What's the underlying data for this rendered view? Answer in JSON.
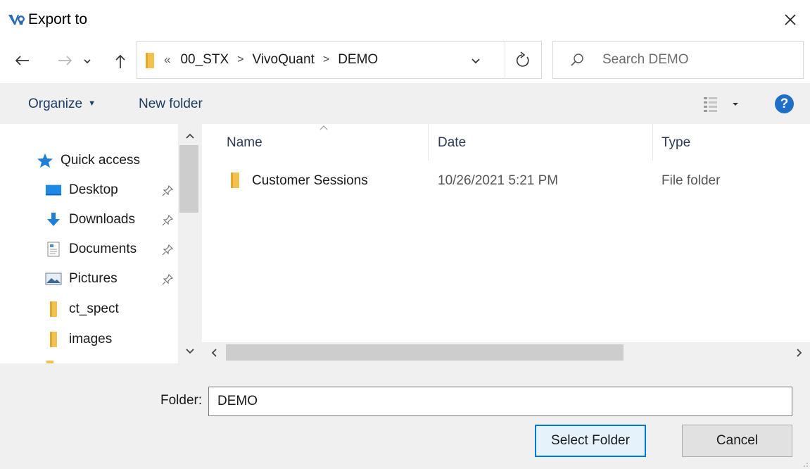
{
  "window": {
    "title": "Export to"
  },
  "nav": {
    "back_icon": "back-arrow-icon",
    "forward_icon": "forward-arrow-icon",
    "recent_icon": "chevron-down-icon",
    "up_icon": "up-arrow-icon",
    "breadcrumb": {
      "overflow": "«",
      "items": [
        "00_STX",
        "VivoQuant",
        "DEMO"
      ],
      "separator": ">"
    },
    "refresh_icon": "refresh-icon",
    "search_placeholder": "Search DEMO"
  },
  "toolbar": {
    "organize_label": "Organize",
    "new_folder_label": "New folder",
    "help_label": "?"
  },
  "sidebar": {
    "items": [
      {
        "label": "Quick access",
        "icon": "star-icon",
        "pinned": false
      },
      {
        "label": "Desktop",
        "icon": "desktop-icon",
        "pinned": true
      },
      {
        "label": "Downloads",
        "icon": "download-icon",
        "pinned": true
      },
      {
        "label": "Documents",
        "icon": "documents-icon",
        "pinned": true
      },
      {
        "label": "Pictures",
        "icon": "pictures-icon",
        "pinned": true
      },
      {
        "label": "ct_spect",
        "icon": "folder-icon",
        "pinned": false
      },
      {
        "label": "images",
        "icon": "folder-icon",
        "pinned": false
      }
    ]
  },
  "files": {
    "columns": [
      "Name",
      "Date",
      "Type"
    ],
    "rows": [
      {
        "name": "Customer Sessions",
        "date": "10/26/2021 5:21 PM",
        "type": "File folder"
      }
    ]
  },
  "footer": {
    "folder_label": "Folder:",
    "folder_value": "DEMO",
    "select_button": "Select Folder",
    "cancel_button": "Cancel"
  },
  "colors": {
    "accent": "#0078d7",
    "folder": "#f2c14e",
    "help": "#1e6fc8",
    "link_text": "#1a3d63"
  }
}
